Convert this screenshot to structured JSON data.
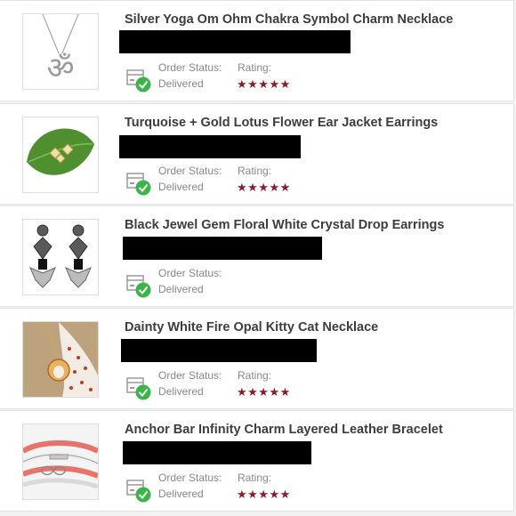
{
  "orders": [
    {
      "title": "Silver Yoga Om Ohm Chakra Symbol Charm Necklace",
      "thumbnail": "om-necklace-thumbnail",
      "status_label": "Order Status:",
      "status_value": "Delivered",
      "rating_label": "Rating:",
      "rating": 5,
      "stars": "★★★★★"
    },
    {
      "title": "Turquoise + Gold Lotus Flower Ear Jacket Earrings",
      "thumbnail": "lotus-earrings-thumbnail",
      "status_label": "Order Status:",
      "status_value": "Delivered",
      "rating_label": "Rating:",
      "rating": 5,
      "stars": "★★★★★"
    },
    {
      "title": "Black Jewel Gem Floral White Crystal Drop Earrings",
      "thumbnail": "crystal-drop-earrings-thumbnail",
      "status_label": "Order Status:",
      "status_value": "Delivered"
    },
    {
      "title": "Dainty White Fire Opal Kitty Cat Necklace",
      "thumbnail": "cat-necklace-thumbnail",
      "status_label": "Order Status:",
      "status_value": "Delivered",
      "rating_label": "Rating:",
      "rating": 5,
      "stars": "★★★★★"
    },
    {
      "title": "Anchor Bar Infinity Charm Layered Leather Bracelet",
      "thumbnail": "leather-bracelet-thumbnail",
      "status_label": "Order Status:",
      "status_value": "Delivered",
      "rating_label": "Rating:",
      "rating": 5,
      "stars": "★★★★★"
    }
  ],
  "icons": {
    "status": "delivered-box-check-icon"
  },
  "colors": {
    "star": "#8b1c2b",
    "check": "#3bb54a",
    "title": "#3d3d3d",
    "muted": "#888888"
  }
}
